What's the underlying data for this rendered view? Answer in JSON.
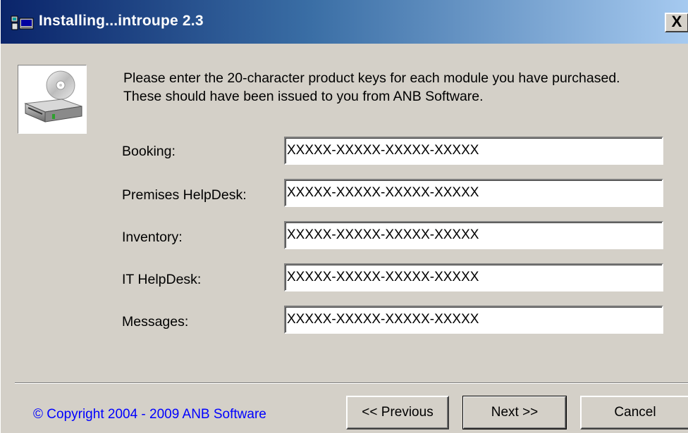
{
  "window": {
    "title": "Installing...introupe 2.3",
    "close_label": "X"
  },
  "intro": {
    "text": "Please enter the 20-character product keys for each module you have purchased. These should have been issued to you from ANB Software."
  },
  "fields": [
    {
      "label": "Booking:",
      "value": "XXXXX-XXXXX-XXXXX-XXXXX"
    },
    {
      "label": "Premises HelpDesk:",
      "value": "XXXXX-XXXXX-XXXXX-XXXXX"
    },
    {
      "label": "Inventory:",
      "value": "XXXXX-XXXXX-XXXXX-XXXXX"
    },
    {
      "label": "IT HelpDesk:",
      "value": "XXXXX-XXXXX-XXXXX-XXXXX"
    },
    {
      "label": "Messages:",
      "value": "XXXXX-XXXXX-XXXXX-XXXXX"
    }
  ],
  "footer": {
    "copyright": "© Copyright 2004 - 2009 ANB Software",
    "previous_label": "<< Previous",
    "next_label": "Next >>",
    "cancel_label": "Cancel"
  },
  "icons": {
    "app": "installer-icon",
    "disk": "disk-drive-cd-icon"
  },
  "colors": {
    "title_gradient_start": "#0a246a",
    "title_gradient_end": "#a6caf0",
    "face": "#d4d0c8",
    "link": "#0000ff"
  }
}
